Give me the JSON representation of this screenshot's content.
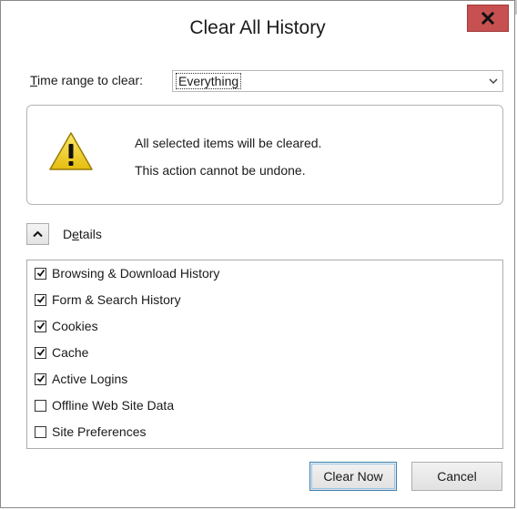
{
  "dialog": {
    "title": "Clear All History",
    "close_glyph": "X"
  },
  "time_range": {
    "label_underlined": "T",
    "label_rest": "ime range to clear:",
    "selected": "Everything",
    "chevron_icon": "chevron-down-icon"
  },
  "warning": {
    "icon": "warning-triangle-icon",
    "line1": "All selected items will be cleared.",
    "line2": "This action cannot be undone.",
    "icon_fill": "#f4d21c"
  },
  "details": {
    "toggle_icon": "chevron-up-icon",
    "label_before": "D",
    "label_underlined": "e",
    "label_after": "tails",
    "expanded": true
  },
  "items": [
    {
      "label": "Browsing & Download History",
      "checked": true
    },
    {
      "label": "Form & Search History",
      "checked": true
    },
    {
      "label": "Cookies",
      "checked": true
    },
    {
      "label": "Cache",
      "checked": true
    },
    {
      "label": "Active Logins",
      "checked": true
    },
    {
      "label": "Offline Web Site Data",
      "checked": false
    },
    {
      "label": "Site Preferences",
      "checked": false
    }
  ],
  "buttons": {
    "clear_now": "Clear Now",
    "cancel": "Cancel"
  },
  "colors": {
    "close_button": "#c75050",
    "default_button_border": "#3c7fb1"
  }
}
